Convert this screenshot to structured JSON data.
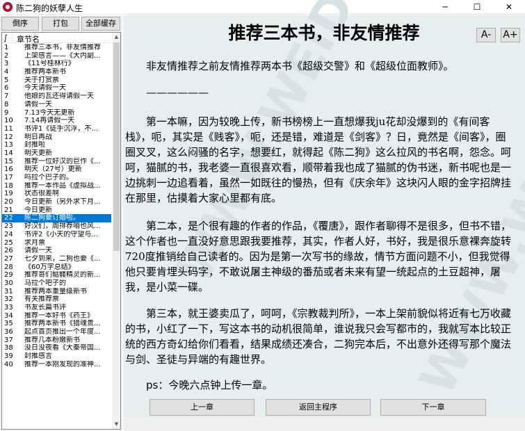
{
  "window": {
    "title": "陈二狗的妖孽人生",
    "minimize_glyph": "─",
    "maximize_glyph": "☐",
    "close_glyph": "✕"
  },
  "toolbar": {
    "reverse_label": "倒序",
    "pack_label": "打包",
    "cache_all_label": "全部缓存"
  },
  "chapter_list": {
    "sort_glyph": "∫",
    "column_header": "章节名",
    "selected_index": 21,
    "rows": [
      {
        "num": "1",
        "title": "推荐三本书，非友情推荐"
      },
      {
        "num": "2",
        "title": "上架感言——《大内副..."
      },
      {
        "num": "3",
        "title": "《11号桂林行》"
      },
      {
        "num": "4",
        "title": "推荐两本新书"
      },
      {
        "num": "5",
        "title": "关于打赏票"
      },
      {
        "num": "6",
        "title": "今天请假一天"
      },
      {
        "num": "7",
        "title": "他娘的瓦还得请假一天"
      },
      {
        "num": "8",
        "title": "请假一天"
      },
      {
        "num": "9",
        "title": "7.13今天无更新"
      },
      {
        "num": "10",
        "title": "7.14再请假一天"
      },
      {
        "num": "11",
        "title": "书评1《徒手沉浮，不..."
      },
      {
        "num": "12",
        "title": "明日再战"
      },
      {
        "num": "13",
        "title": "封推啦"
      },
      {
        "num": "14",
        "title": "明天更新"
      },
      {
        "num": "15",
        "title": "推荐一位好汉的巨作《..."
      },
      {
        "num": "16",
        "title": "明天（27号）更新"
      },
      {
        "num": "17",
        "title": "吗拉个巴子的。"
      },
      {
        "num": "18",
        "title": "推荐一本作品《虚拟战..."
      },
      {
        "num": "19",
        "title": "状态很差啊"
      },
      {
        "num": "20",
        "title": "今日更新（另外求下月..."
      },
      {
        "num": "21",
        "title": "今日更新"
      },
      {
        "num": "22",
        "title": "陈二狗要订婚啦。"
      },
      {
        "num": "23",
        "title": "好汉们，周排荐咱也风..."
      },
      {
        "num": "24",
        "title": "书评2《小天的守望与..."
      },
      {
        "num": "25",
        "title": "求月票"
      },
      {
        "num": "26",
        "title": "请假一天"
      },
      {
        "num": "27",
        "title": "七夕到来，二狗也要《..."
      },
      {
        "num": "28",
        "title": "《60万字总结》"
      },
      {
        "num": "29",
        "title": "推荐哥们骷髅精灵的新..."
      },
      {
        "num": "30",
        "title": "马拉个吧子的"
      },
      {
        "num": "31",
        "title": "推荐两本重量级新书"
      },
      {
        "num": "32",
        "title": "有关推荐票"
      },
      {
        "num": "33",
        "title": "书友长篇书评"
      },
      {
        "num": "34",
        "title": "推荐一本好书《药王》"
      },
      {
        "num": "35",
        "title": "推荐两本新书《猎魂贵..."
      },
      {
        "num": "36",
        "title": "起点首页推出一个年度..."
      },
      {
        "num": "37",
        "title": "推荐几本粉嫩新书"
      },
      {
        "num": "38",
        "title": "没日没夜看《大秦帝国..."
      },
      {
        "num": "39",
        "title": "封推感言"
      },
      {
        "num": "40",
        "title": "推荐一本刚发现的准神..."
      }
    ]
  },
  "reader": {
    "title": "推荐三本书，非友情推荐",
    "font_decrease_label": "A-",
    "font_increase_label": "A+",
    "paragraphs": [
      "　　非友情推荐之前友情推荐两本书《超级交警》和《超级位面教师》。",
      "　　——————",
      "　　第一本嘛，因为较晚上传，新书榜榜上一直想爆我ju花却没爆到的《有间客栈》，呃，其实是《贱客》，呃，还是错，难道是《剑客》？日，竟然是《间客》，圈圈叉叉，这么闷骚的名字，想要红，就得起《陈二狗》这么拉风的书名啊，怨念。呵呵，猫腻的书，我老婆一直很喜欢看，顺带着我也成了猫腻的伪书迷，新书呢也是一边挑刺一边追看着，虽然一如既往的慢热，但有《庆余年》这块闪人眼的金字招牌挂在那里，估摸着大家心里都有底。",
      "　　第二本，是个很有趣的作者的作品，《覆唐》，跟作者聊得不是很多，但书不错，这个作者也一直没好意思跟我要推荐，其实，作者人好，书好，我是很乐意裸奔旋转720度推销给自己读者的。因为是第一次写书的缘故，情节方面问题不小，但我觉得他只要肯埋头码字，不敢说屠主神级的番茄或者未来有望一统起点的土豆超神，屠我，是小菜一碟。",
      "　　第三本，就王婆卖瓜了，呵呵，《宗教裁判所》，一本上架前貌似将近有七万收藏的书，小红了一下，写这本书的动机很简单，谁说我只会写都市的，我就写本比较正统的西方奇幻给你们看看，结果成绩还凑合，二狗完本后，不出意外还得写那个魔法与剑、圣徒与异端的有趣世界。"
    ],
    "ps_label": "ps",
    "ps_text": "：今晚六点钟上传一章。",
    "prev_label": "上一章",
    "home_label": "返回主程序",
    "next_label": "下一章",
    "watermark_text": "WWW.WEIDOWN.COM"
  }
}
